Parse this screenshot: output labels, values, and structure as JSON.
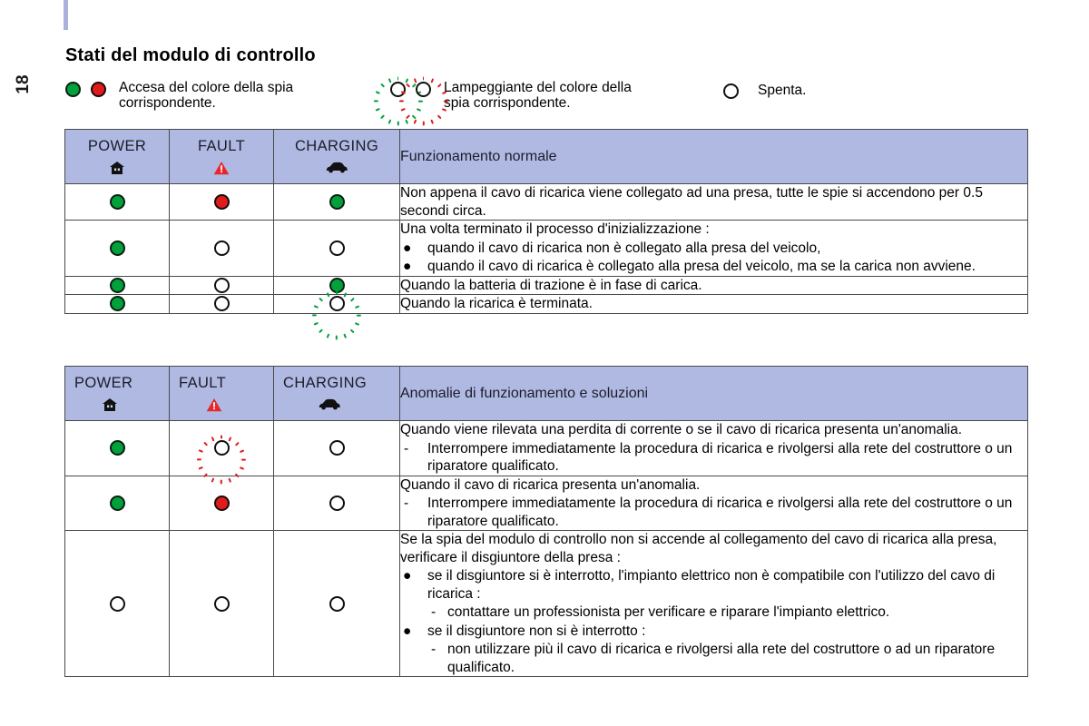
{
  "page": {
    "number": "18",
    "title": "Stati del modulo di controllo"
  },
  "legend": {
    "items": [
      {
        "lamps": [
          "green",
          "red"
        ],
        "text": "Accesa del colore della spia\ncorrispondente."
      },
      {
        "lamps": [
          "flash-green",
          "flash-red"
        ],
        "text": "Lampeggiante del colore della\nspia corrispondente."
      },
      {
        "lamps": [
          "off"
        ],
        "text": "Spenta."
      }
    ]
  },
  "colors": {
    "header_bg": "#b0b9e2",
    "green": "#00a13a",
    "red": "#e01b1b",
    "border": "#4a4a4a",
    "accent_bar": "#aab2dc"
  },
  "table_normal": {
    "headers": {
      "power": "POWER",
      "fault": "FAULT",
      "charging": "CHARGING",
      "description": "Funzionamento normale",
      "power_icon": "house-icon",
      "fault_icon": "warning-triangle-icon",
      "charging_icon": "car-icon"
    },
    "rows": [
      {
        "power": "green",
        "fault": "red",
        "charging": "green",
        "lead": "Non appena il cavo di ricarica viene collegato ad una presa, tutte le spie si accendono per 0.5 secondi circa.",
        "bullets": []
      },
      {
        "power": "green",
        "fault": "off",
        "charging": "off",
        "lead": "Una volta terminato il processo d'inizializzazione :",
        "bullets": [
          {
            "marker": "●",
            "text": "quando il cavo di ricarica non è collegato alla presa del veicolo,"
          },
          {
            "marker": "●",
            "text": "quando il cavo di ricarica è collegato alla presa del veicolo, ma se la carica non avviene."
          }
        ]
      },
      {
        "power": "green",
        "fault": "off",
        "charging": "green",
        "lead": "Quando la batteria di trazione è in fase di carica.",
        "bullets": []
      },
      {
        "power": "green",
        "fault": "off",
        "charging": "flash-green",
        "lead": "Quando la ricarica è terminata.",
        "bullets": []
      }
    ]
  },
  "table_faults": {
    "headers": {
      "power": "POWER",
      "fault": "FAULT",
      "charging": "CHARGING",
      "description": "Anomalie di funzionamento e soluzioni",
      "power_icon": "house-icon",
      "fault_icon": "warning-triangle-icon",
      "charging_icon": "car-icon"
    },
    "rows": [
      {
        "power": "green",
        "fault": "flash-red",
        "charging": "off",
        "lead": "Quando viene rilevata una perdita di corrente o se il cavo di ricarica presenta un'anomalia.",
        "bullets": [
          {
            "marker": "-",
            "text": "Interrompere immediatamente la procedura di ricarica e rivolgersi alla rete del costruttore o un riparatore qualificato."
          }
        ]
      },
      {
        "power": "green",
        "fault": "red",
        "charging": "off",
        "lead": "Quando il cavo di ricarica presenta un'anomalia.",
        "bullets": [
          {
            "marker": "-",
            "text": "Interrompere immediatamente la procedura di ricarica e rivolgersi alla rete del costruttore o un riparatore qualificato."
          }
        ]
      },
      {
        "power": "off",
        "fault": "off",
        "charging": "off",
        "lead": "Se la spia del modulo di controllo non si accende al collegamento del cavo di ricarica alla presa, verificare il disgiuntore della presa :",
        "bullets": [
          {
            "marker": "●",
            "text": "se il disgiuntore si è interrotto, l'impianto elettrico non è compatibile con l'utilizzo del cavo di ricarica :"
          },
          {
            "marker": "-",
            "text": "contattare un professionista per verificare e riparare l'impianto elettrico.",
            "indent": true
          },
          {
            "marker": "●",
            "text": "se il disgiuntore non si è interrotto :"
          },
          {
            "marker": "-",
            "text": "non utilizzare più il cavo di ricarica e rivolgersi alla rete del costruttore o ad un riparatore qualificato.",
            "indent": true
          }
        ]
      }
    ]
  }
}
